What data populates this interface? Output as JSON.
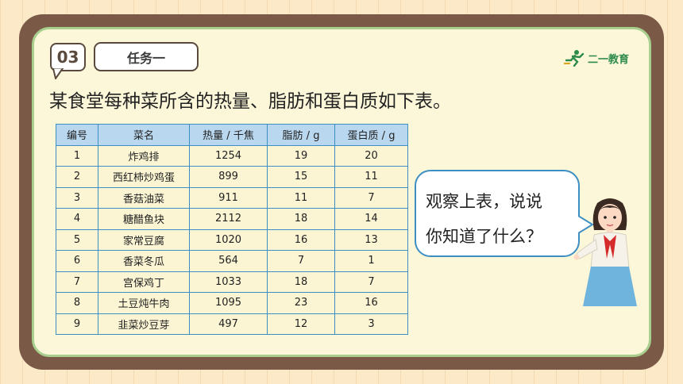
{
  "badge": {
    "number": "03"
  },
  "task": {
    "label": "任务一"
  },
  "logo": {
    "text": "二一教育",
    "icon": "running-figure-icon"
  },
  "heading": "某食堂每种菜所含的热量、脂肪和蛋白质如下表。",
  "table": {
    "headers": [
      "编号",
      "菜名",
      "热量 / 千焦",
      "脂肪 / g",
      "蛋白质 / g"
    ],
    "rows": [
      [
        "1",
        "炸鸡排",
        "1254",
        "19",
        "20"
      ],
      [
        "2",
        "西红柿炒鸡蛋",
        "899",
        "15",
        "11"
      ],
      [
        "3",
        "香菇油菜",
        "911",
        "11",
        "7"
      ],
      [
        "4",
        "糖醋鱼块",
        "2112",
        "18",
        "14"
      ],
      [
        "5",
        "家常豆腐",
        "1020",
        "16",
        "13"
      ],
      [
        "6",
        "香菜冬瓜",
        "564",
        "7",
        "1"
      ],
      [
        "7",
        "宫保鸡丁",
        "1033",
        "18",
        "7"
      ],
      [
        "8",
        "土豆炖牛肉",
        "1095",
        "23",
        "16"
      ],
      [
        "9",
        "韭菜炒豆芽",
        "497",
        "12",
        "3"
      ]
    ]
  },
  "bubble": {
    "line1": "观察上表，说说",
    "line2": "你知道了什么？"
  },
  "colors": {
    "frame": "#7a5a46",
    "board": "#fcf7d9",
    "border": "#a8cf8e",
    "table_border": "#3d8fc3",
    "header_bg": "#b9d7ef"
  }
}
